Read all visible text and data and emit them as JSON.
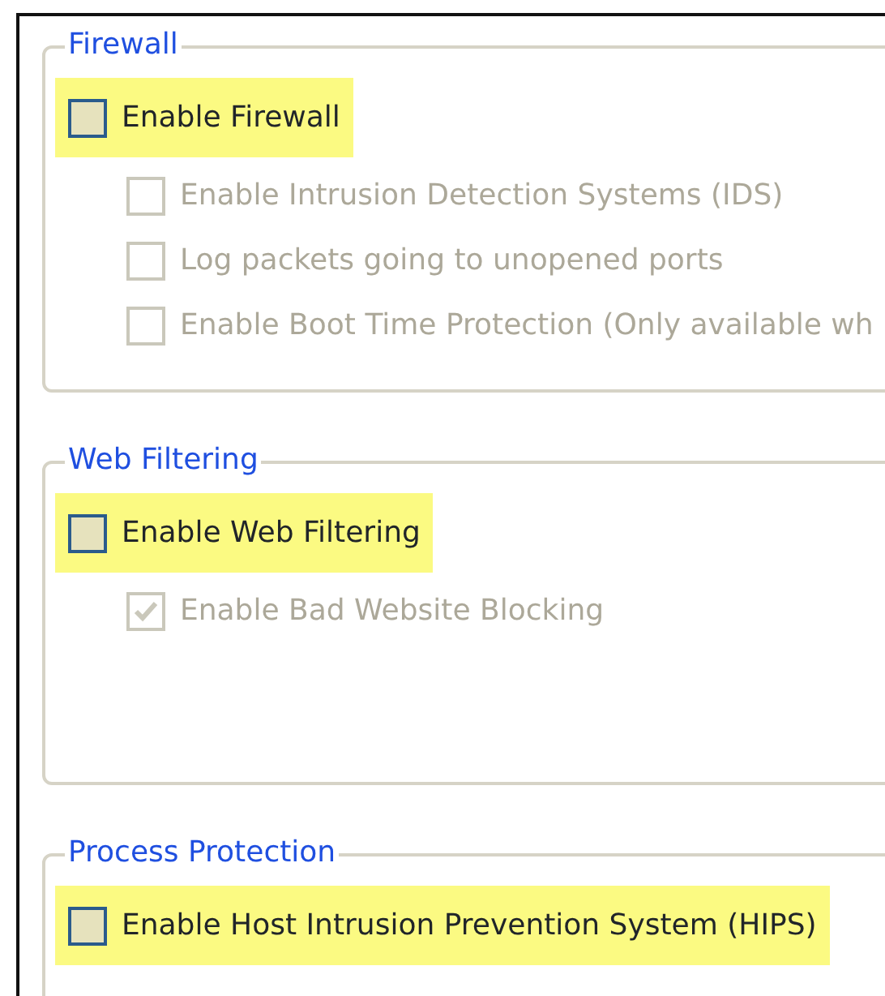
{
  "groups": [
    {
      "title": "Firewall",
      "option": {
        "label": "Enable Firewall",
        "checked": false,
        "highlighted": true,
        "children": [
          {
            "label": "Enable Intrusion Detection Systems (IDS)",
            "checked": false,
            "disabled": true
          },
          {
            "label": "Log packets going to unopened ports",
            "checked": false,
            "disabled": true
          },
          {
            "label": "Enable Boot Time Protection (Only available wh",
            "checked": false,
            "disabled": true
          }
        ]
      }
    },
    {
      "title": "Web Filtering",
      "option": {
        "label": "Enable Web Filtering",
        "checked": false,
        "highlighted": true,
        "children": [
          {
            "label": "Enable Bad Website Blocking",
            "checked": true,
            "disabled": true
          }
        ]
      }
    },
    {
      "title": "Process Protection",
      "option": {
        "label": "Enable Host Intrusion Prevention System (HIPS)",
        "checked": false,
        "highlighted": true
      }
    }
  ]
}
